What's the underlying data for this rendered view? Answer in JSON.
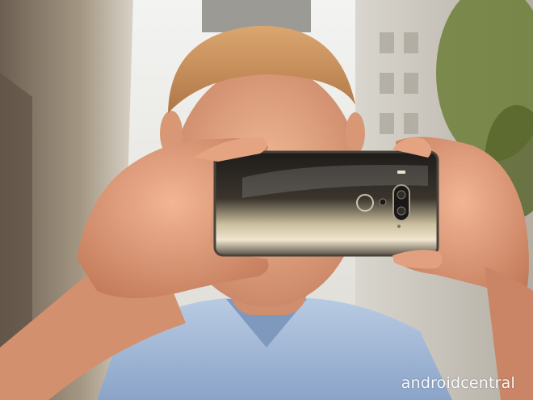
{
  "photo": {
    "subject": "person-holding-smartphone",
    "watermark": "androidcentral",
    "colors": {
      "sky": "#eef0ee",
      "building_left": "#8c7f6e",
      "building_right": "#c9c5bd",
      "foliage": "#6f7f3a",
      "skin": "#e3a483",
      "hair": "#c98a5a",
      "shirt": "#9fb7d6",
      "phone_body": "#2a2724",
      "phone_sheen": "#e8dcc4"
    }
  }
}
